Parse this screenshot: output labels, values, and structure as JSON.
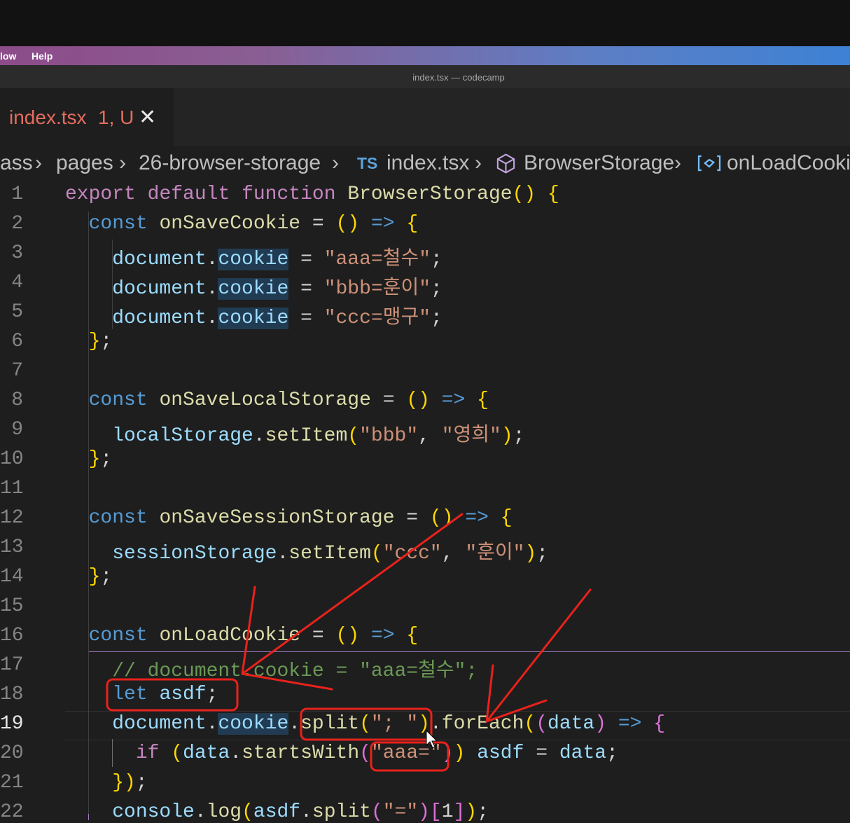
{
  "menubar": {
    "items": [
      "low",
      "Help"
    ]
  },
  "window_title": "index.tsx — codecamp",
  "tab": {
    "name": "index.tsx",
    "status": "1, U"
  },
  "breadcrumb": {
    "items": [
      "ass",
      "pages",
      "26-browser-storage",
      "index.tsx",
      "BrowserStorage",
      "onLoadCooki"
    ],
    "ts_badge": "TS"
  },
  "editor": {
    "active_line": 19,
    "lines": [
      {
        "n": "1",
        "text": "export default function BrowserStorage() {"
      },
      {
        "n": "2",
        "text": "  const onSaveCookie = () => {"
      },
      {
        "n": "3",
        "text": "    document.cookie = \"aaa=철수\";"
      },
      {
        "n": "4",
        "text": "    document.cookie = \"bbb=훈이\";"
      },
      {
        "n": "5",
        "text": "    document.cookie = \"ccc=맹구\";"
      },
      {
        "n": "6",
        "text": "  };"
      },
      {
        "n": "7",
        "text": ""
      },
      {
        "n": "8",
        "text": "  const onSaveLocalStorage = () => {"
      },
      {
        "n": "9",
        "text": "    localStorage.setItem(\"bbb\", \"영희\");"
      },
      {
        "n": "10",
        "text": "  };"
      },
      {
        "n": "11",
        "text": ""
      },
      {
        "n": "12",
        "text": "  const onSaveSessionStorage = () => {"
      },
      {
        "n": "13",
        "text": "    sessionStorage.setItem(\"ccc\", \"훈이\");"
      },
      {
        "n": "14",
        "text": "  };"
      },
      {
        "n": "15",
        "text": ""
      },
      {
        "n": "16",
        "text": "  const onLoadCookie = () => {"
      },
      {
        "n": "17",
        "text": "    // document.cookie = \"aaa=철수\";"
      },
      {
        "n": "18",
        "text": "    let asdf;"
      },
      {
        "n": "19",
        "text": "    document.cookie.split(\"; \").forEach((data) => {"
      },
      {
        "n": "20",
        "text": "      if (data.startsWith(\"aaa=\")) asdf = data;"
      },
      {
        "n": "21",
        "text": "    });"
      },
      {
        "n": "22",
        "text": "    console.log(asdf.split(\"=\")[1]);"
      }
    ]
  },
  "colors": {
    "keyword": "#c586c0",
    "storage": "#569cd6",
    "function": "#dcdcaa",
    "variable": "#9cdcfe",
    "string": "#ce9178",
    "comment": "#6a9955",
    "annotation": "#e8221b",
    "tab_modified": "#e36d5e"
  },
  "icons": [
    "close-icon",
    "chevron-right-icon",
    "typescript-file-icon",
    "cube-icon",
    "field-icon",
    "mouse-cursor-icon"
  ]
}
